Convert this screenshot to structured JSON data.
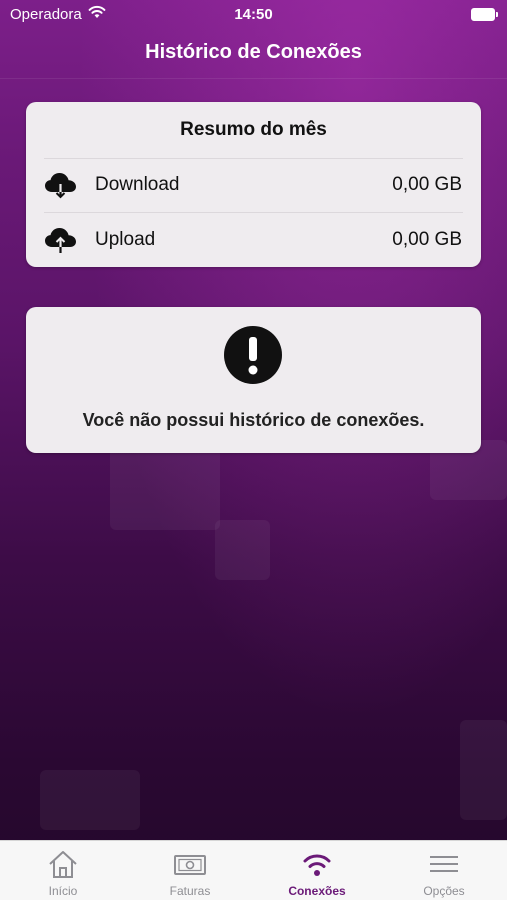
{
  "status_bar": {
    "carrier": "Operadora",
    "time": "14:50",
    "wifi_icon": "wifi-icon",
    "battery_icon": "battery-icon"
  },
  "nav": {
    "title": "Histórico de Conexões"
  },
  "summary": {
    "title": "Resumo do mês",
    "rows": [
      {
        "icon": "cloud-download-icon",
        "label": "Download",
        "value": "0,00 GB"
      },
      {
        "icon": "cloud-upload-icon",
        "label": "Upload",
        "value": "0,00 GB"
      }
    ]
  },
  "empty_state": {
    "icon": "exclamation-icon",
    "message": "Você não possui histórico de conexões."
  },
  "tabs": [
    {
      "label": "Início",
      "icon": "home-icon",
      "active": false
    },
    {
      "label": "Faturas",
      "icon": "bill-icon",
      "active": false
    },
    {
      "label": "Conexões",
      "icon": "wifi-icon",
      "active": true
    },
    {
      "label": "Opções",
      "icon": "menu-icon",
      "active": false
    }
  ],
  "colors": {
    "accent": "#6b1a78",
    "background_top": "#7d1f8a",
    "background_bottom": "#23072a",
    "card": "#efecef",
    "tab_inactive": "#8e8e93"
  }
}
